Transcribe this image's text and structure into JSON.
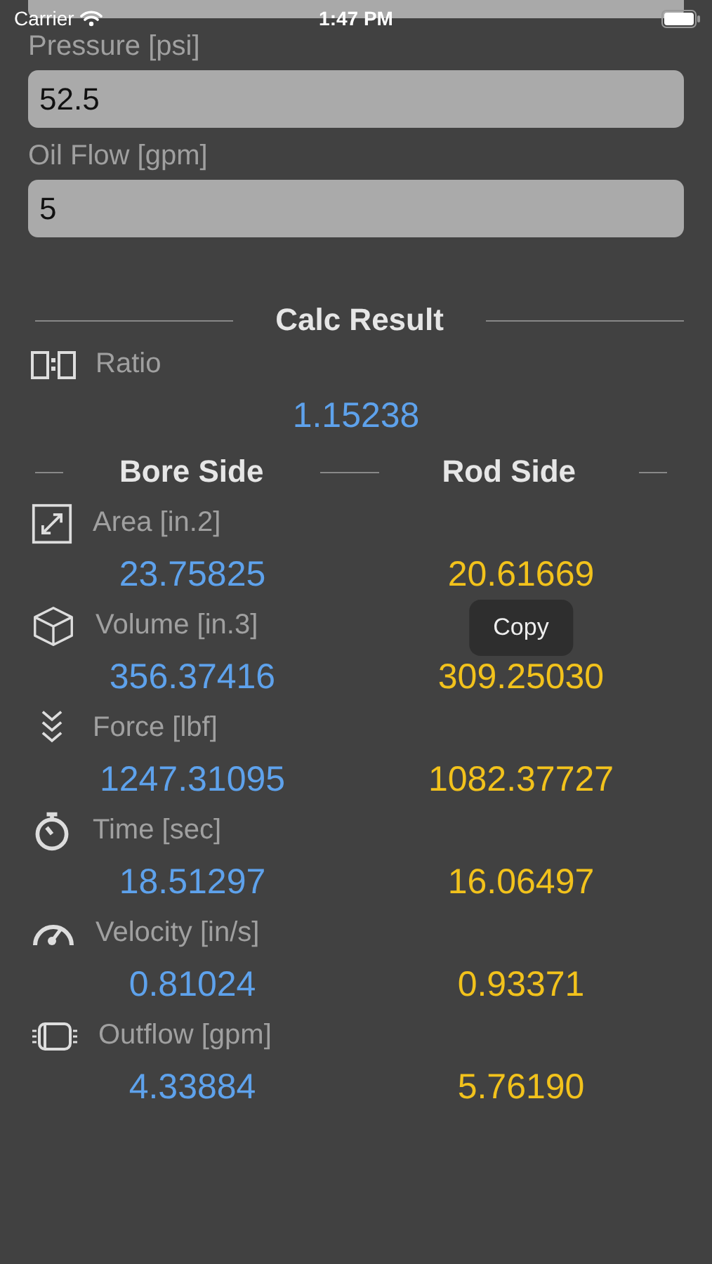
{
  "status_bar": {
    "carrier": "Carrier",
    "time": "1:47 PM"
  },
  "inputs": [
    {
      "label": "Pressure [psi]",
      "value": "52.5"
    },
    {
      "label": "Oil Flow [gpm]",
      "value": "5"
    }
  ],
  "result": {
    "title": "Calc Result",
    "ratio": {
      "label": "Ratio",
      "value": "1.15238"
    },
    "columns": [
      "Bore Side",
      "Rod Side"
    ],
    "metrics": [
      {
        "kind": "area",
        "label": "Area [in.2]",
        "bore": "23.75825",
        "rod": "20.61669"
      },
      {
        "kind": "volume",
        "label": "Volume  [in.3]",
        "bore": "356.37416",
        "rod": "309.25030"
      },
      {
        "kind": "force",
        "label": "Force [lbf]",
        "bore": "1247.31095",
        "rod": "1082.37727"
      },
      {
        "kind": "time",
        "label": "Time [sec]",
        "bore": "18.51297",
        "rod": "16.06497"
      },
      {
        "kind": "velocity",
        "label": "Velocity [in/s]",
        "bore": "0.81024",
        "rod": "0.93371"
      },
      {
        "kind": "outflow",
        "label": "Outflow [gpm]",
        "bore": "4.33884",
        "rod": "5.76190"
      }
    ],
    "tooltip": "Copy"
  }
}
